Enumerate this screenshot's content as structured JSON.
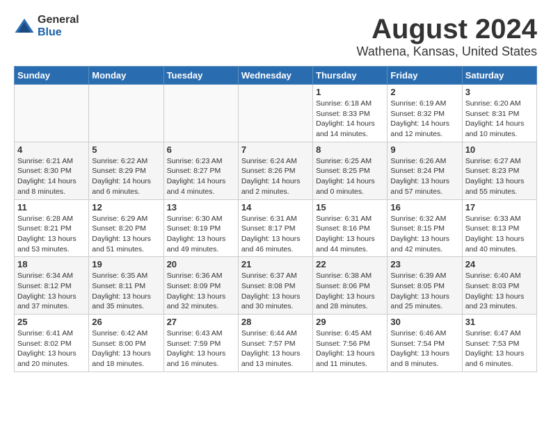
{
  "logo": {
    "general": "General",
    "blue": "Blue"
  },
  "title": "August 2024",
  "subtitle": "Wathena, Kansas, United States",
  "days_of_week": [
    "Sunday",
    "Monday",
    "Tuesday",
    "Wednesday",
    "Thursday",
    "Friday",
    "Saturday"
  ],
  "weeks": [
    [
      {
        "day": "",
        "info": ""
      },
      {
        "day": "",
        "info": ""
      },
      {
        "day": "",
        "info": ""
      },
      {
        "day": "",
        "info": ""
      },
      {
        "day": "1",
        "info": "Sunrise: 6:18 AM\nSunset: 8:33 PM\nDaylight: 14 hours and 14 minutes."
      },
      {
        "day": "2",
        "info": "Sunrise: 6:19 AM\nSunset: 8:32 PM\nDaylight: 14 hours and 12 minutes."
      },
      {
        "day": "3",
        "info": "Sunrise: 6:20 AM\nSunset: 8:31 PM\nDaylight: 14 hours and 10 minutes."
      }
    ],
    [
      {
        "day": "4",
        "info": "Sunrise: 6:21 AM\nSunset: 8:30 PM\nDaylight: 14 hours and 8 minutes."
      },
      {
        "day": "5",
        "info": "Sunrise: 6:22 AM\nSunset: 8:29 PM\nDaylight: 14 hours and 6 minutes."
      },
      {
        "day": "6",
        "info": "Sunrise: 6:23 AM\nSunset: 8:27 PM\nDaylight: 14 hours and 4 minutes."
      },
      {
        "day": "7",
        "info": "Sunrise: 6:24 AM\nSunset: 8:26 PM\nDaylight: 14 hours and 2 minutes."
      },
      {
        "day": "8",
        "info": "Sunrise: 6:25 AM\nSunset: 8:25 PM\nDaylight: 14 hours and 0 minutes."
      },
      {
        "day": "9",
        "info": "Sunrise: 6:26 AM\nSunset: 8:24 PM\nDaylight: 13 hours and 57 minutes."
      },
      {
        "day": "10",
        "info": "Sunrise: 6:27 AM\nSunset: 8:23 PM\nDaylight: 13 hours and 55 minutes."
      }
    ],
    [
      {
        "day": "11",
        "info": "Sunrise: 6:28 AM\nSunset: 8:21 PM\nDaylight: 13 hours and 53 minutes."
      },
      {
        "day": "12",
        "info": "Sunrise: 6:29 AM\nSunset: 8:20 PM\nDaylight: 13 hours and 51 minutes."
      },
      {
        "day": "13",
        "info": "Sunrise: 6:30 AM\nSunset: 8:19 PM\nDaylight: 13 hours and 49 minutes."
      },
      {
        "day": "14",
        "info": "Sunrise: 6:31 AM\nSunset: 8:17 PM\nDaylight: 13 hours and 46 minutes."
      },
      {
        "day": "15",
        "info": "Sunrise: 6:31 AM\nSunset: 8:16 PM\nDaylight: 13 hours and 44 minutes."
      },
      {
        "day": "16",
        "info": "Sunrise: 6:32 AM\nSunset: 8:15 PM\nDaylight: 13 hours and 42 minutes."
      },
      {
        "day": "17",
        "info": "Sunrise: 6:33 AM\nSunset: 8:13 PM\nDaylight: 13 hours and 40 minutes."
      }
    ],
    [
      {
        "day": "18",
        "info": "Sunrise: 6:34 AM\nSunset: 8:12 PM\nDaylight: 13 hours and 37 minutes."
      },
      {
        "day": "19",
        "info": "Sunrise: 6:35 AM\nSunset: 8:11 PM\nDaylight: 13 hours and 35 minutes."
      },
      {
        "day": "20",
        "info": "Sunrise: 6:36 AM\nSunset: 8:09 PM\nDaylight: 13 hours and 32 minutes."
      },
      {
        "day": "21",
        "info": "Sunrise: 6:37 AM\nSunset: 8:08 PM\nDaylight: 13 hours and 30 minutes."
      },
      {
        "day": "22",
        "info": "Sunrise: 6:38 AM\nSunset: 8:06 PM\nDaylight: 13 hours and 28 minutes."
      },
      {
        "day": "23",
        "info": "Sunrise: 6:39 AM\nSunset: 8:05 PM\nDaylight: 13 hours and 25 minutes."
      },
      {
        "day": "24",
        "info": "Sunrise: 6:40 AM\nSunset: 8:03 PM\nDaylight: 13 hours and 23 minutes."
      }
    ],
    [
      {
        "day": "25",
        "info": "Sunrise: 6:41 AM\nSunset: 8:02 PM\nDaylight: 13 hours and 20 minutes."
      },
      {
        "day": "26",
        "info": "Sunrise: 6:42 AM\nSunset: 8:00 PM\nDaylight: 13 hours and 18 minutes."
      },
      {
        "day": "27",
        "info": "Sunrise: 6:43 AM\nSunset: 7:59 PM\nDaylight: 13 hours and 16 minutes."
      },
      {
        "day": "28",
        "info": "Sunrise: 6:44 AM\nSunset: 7:57 PM\nDaylight: 13 hours and 13 minutes."
      },
      {
        "day": "29",
        "info": "Sunrise: 6:45 AM\nSunset: 7:56 PM\nDaylight: 13 hours and 11 minutes."
      },
      {
        "day": "30",
        "info": "Sunrise: 6:46 AM\nSunset: 7:54 PM\nDaylight: 13 hours and 8 minutes."
      },
      {
        "day": "31",
        "info": "Sunrise: 6:47 AM\nSunset: 7:53 PM\nDaylight: 13 hours and 6 minutes."
      }
    ]
  ]
}
